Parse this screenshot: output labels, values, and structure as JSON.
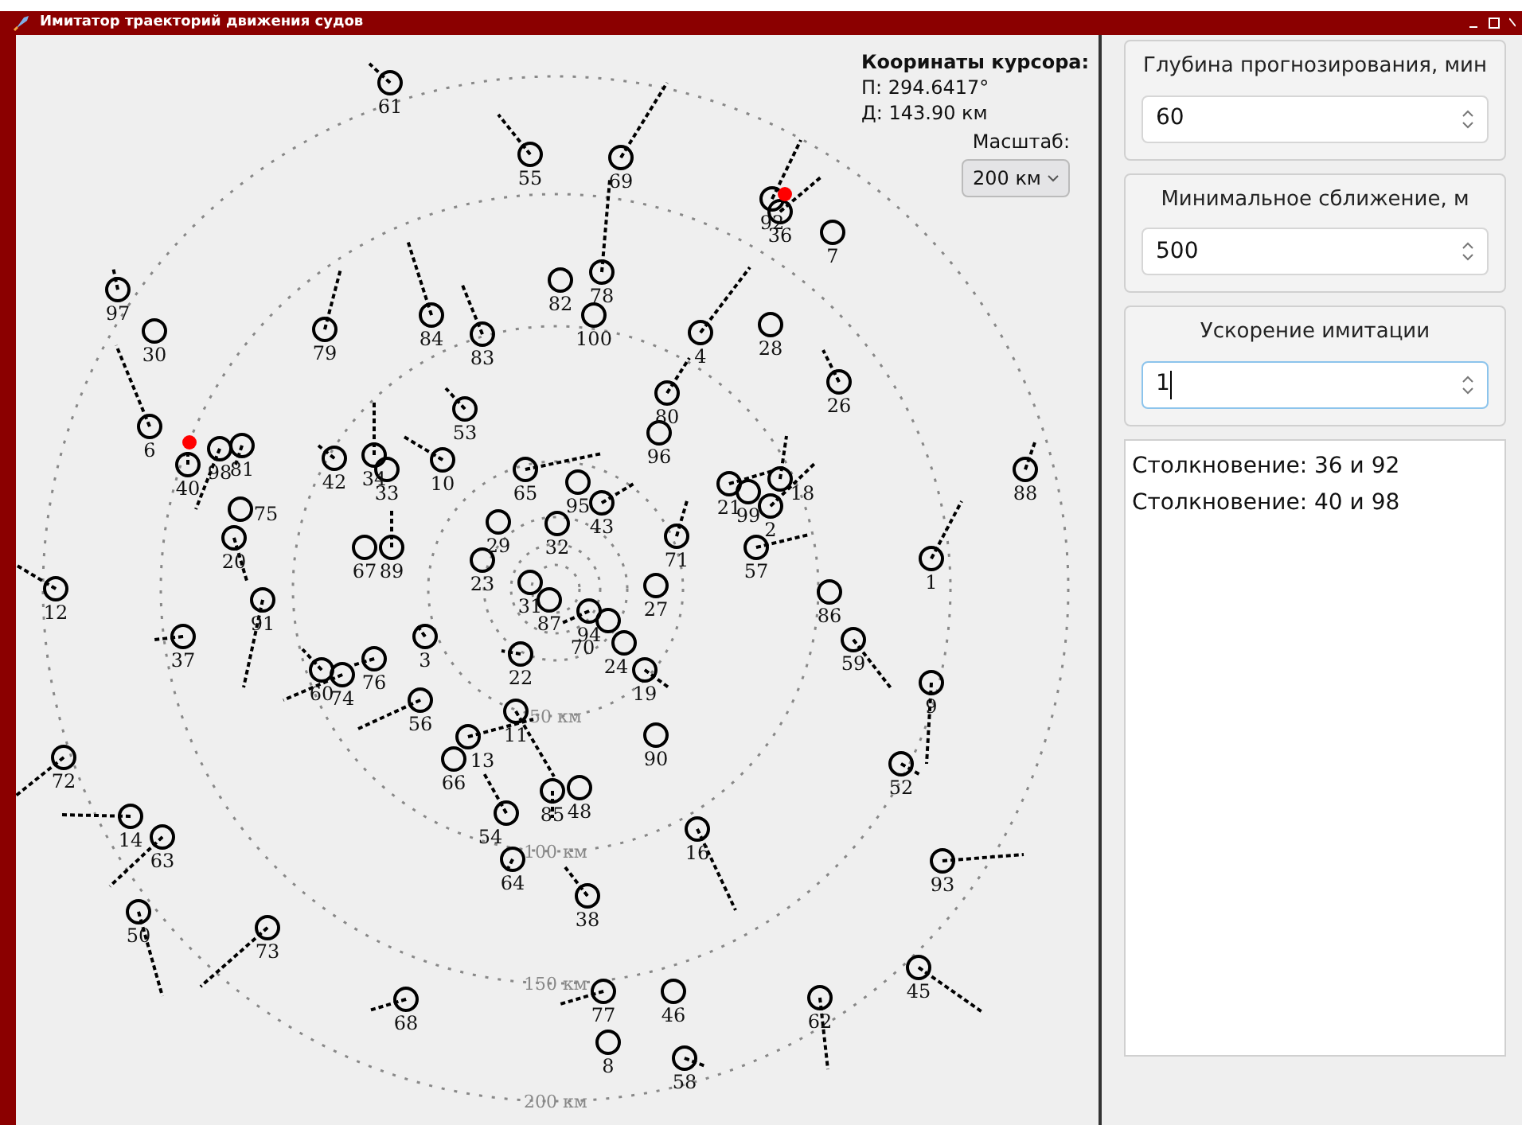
{
  "window": {
    "title": "Имитатор траекторий движения судов"
  },
  "radar": {
    "cursor": {
      "title": "Кооринаты курсора:",
      "bearing": "П: 294.6417°",
      "distance": "Д: 143.90 км"
    },
    "scale": {
      "label": "Масштаб:",
      "value": "200 км"
    },
    "rings": [
      {
        "label": "50 км"
      },
      {
        "label": "100 км"
      },
      {
        "label": "150 км"
      },
      {
        "label": "200 км"
      }
    ],
    "ships": [
      {
        "label": "61"
      },
      {
        "label": "55"
      },
      {
        "label": "69"
      },
      {
        "label": "92"
      },
      {
        "label": "36"
      },
      {
        "label": "7"
      },
      {
        "label": "97"
      },
      {
        "label": "82"
      },
      {
        "label": "78"
      },
      {
        "label": "30"
      },
      {
        "label": "79"
      },
      {
        "label": "84"
      },
      {
        "label": "83"
      },
      {
        "label": "100"
      },
      {
        "label": "4"
      },
      {
        "label": "28"
      },
      {
        "label": "80"
      },
      {
        "label": "26"
      },
      {
        "label": "53"
      },
      {
        "label": "6"
      },
      {
        "label": "96"
      },
      {
        "label": "40"
      },
      {
        "label": "98"
      },
      {
        "label": "81"
      },
      {
        "label": "42"
      },
      {
        "label": "34"
      },
      {
        "label": "33"
      },
      {
        "label": "10"
      },
      {
        "label": "65"
      },
      {
        "label": "88"
      },
      {
        "label": "95"
      },
      {
        "label": "21"
      },
      {
        "label": "99"
      },
      {
        "label": "18"
      },
      {
        "label": "75"
      },
      {
        "label": "43"
      },
      {
        "label": "2"
      },
      {
        "label": "29"
      },
      {
        "label": "32"
      },
      {
        "label": "20"
      },
      {
        "label": "71"
      },
      {
        "label": "67"
      },
      {
        "label": "89"
      },
      {
        "label": "23"
      },
      {
        "label": "57"
      },
      {
        "label": "1"
      },
      {
        "label": "12"
      },
      {
        "label": "91"
      },
      {
        "label": "31"
      },
      {
        "label": "87"
      },
      {
        "label": "27"
      },
      {
        "label": "86"
      },
      {
        "label": "94"
      },
      {
        "label": "70"
      },
      {
        "label": "37"
      },
      {
        "label": "3"
      },
      {
        "label": "24"
      },
      {
        "label": "59"
      },
      {
        "label": "76"
      },
      {
        "label": "22"
      },
      {
        "label": "60"
      },
      {
        "label": "74"
      },
      {
        "label": "19"
      },
      {
        "label": "9"
      },
      {
        "label": "56"
      },
      {
        "label": "11"
      },
      {
        "label": "13"
      },
      {
        "label": "90"
      },
      {
        "label": "72"
      },
      {
        "label": "66"
      },
      {
        "label": "52"
      },
      {
        "label": "85"
      },
      {
        "label": "48"
      },
      {
        "label": "14"
      },
      {
        "label": "54"
      },
      {
        "label": "63"
      },
      {
        "label": "64"
      },
      {
        "label": "16"
      },
      {
        "label": "93"
      },
      {
        "label": "38"
      },
      {
        "label": "50"
      },
      {
        "label": "73"
      },
      {
        "label": "45"
      },
      {
        "label": "68"
      },
      {
        "label": "77"
      },
      {
        "label": "46"
      },
      {
        "label": "62"
      },
      {
        "label": "8"
      },
      {
        "label": "58"
      }
    ]
  },
  "settings": [
    {
      "title": "Глубина прогнозирования, мин",
      "value": "60",
      "focused": false
    },
    {
      "title": "Минимальное сближение, м",
      "value": "500",
      "focused": false
    },
    {
      "title": "Ускорение имитации",
      "value": "1",
      "focused": true
    }
  ],
  "log": [
    "Столкновение: 36 и 92",
    "Столкновение: 40 и 98"
  ]
}
